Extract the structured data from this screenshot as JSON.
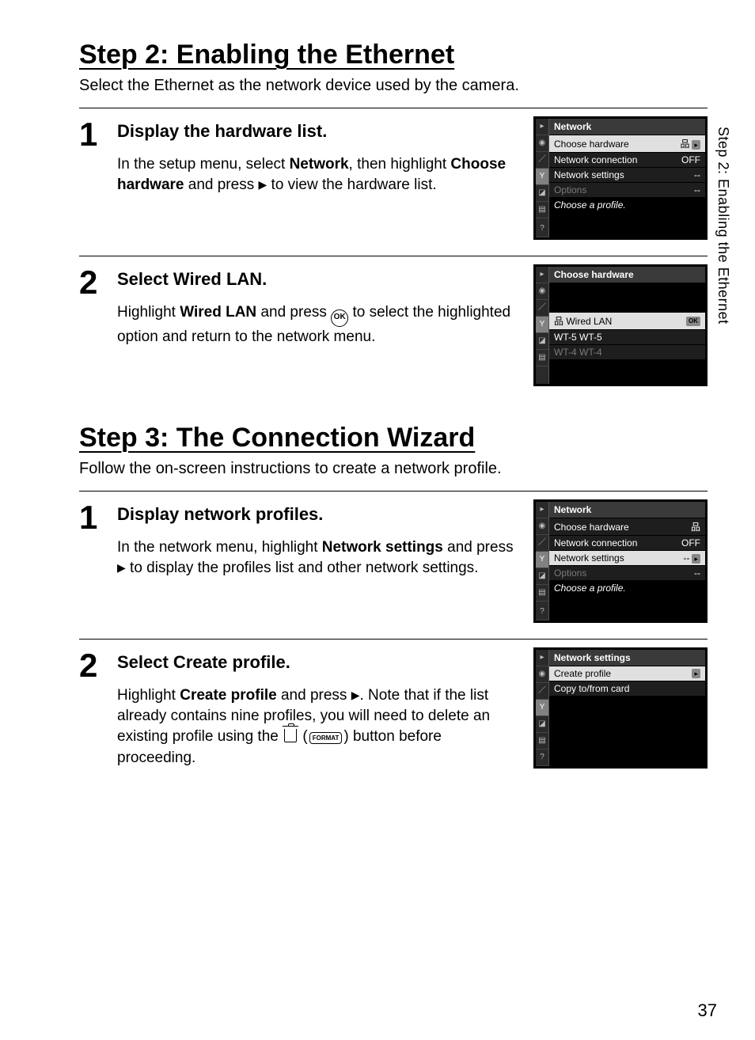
{
  "side_tab": "Step 2: Enabling the Ethernet",
  "step2": {
    "title": "Step 2: Enabling the Ethernet",
    "intro": "Select the Ethernet as the network device used by the camera.",
    "items": [
      {
        "num": "1",
        "heading": "Display the hardware list.",
        "body_pre": "In the setup menu, select ",
        "body_bold1": "Network",
        "body_mid": ", then highlight ",
        "body_bold2": "Choose hardware",
        "body_post": " and press ",
        "body_tail": " to view the hardware list.",
        "cam": {
          "title": "Network",
          "rows": [
            {
              "label": "Choose hardware",
              "val": "品",
              "hi": true,
              "arrow": true
            },
            {
              "label": "Network connection",
              "val": "OFF"
            },
            {
              "label": "Network settings",
              "val": "--"
            },
            {
              "label": "Options",
              "val": "--",
              "dim": true
            }
          ],
          "note": "Choose a profile."
        }
      },
      {
        "num": "2",
        "heading": "Select Wired LAN.",
        "body_pre": "Highlight ",
        "body_bold1": "Wired LAN",
        "body_mid": " and press ",
        "body_post": " to select the highlighted option and return to the network menu.",
        "cam": {
          "title": "Choose hardware",
          "rows": [
            {
              "label": "品  Wired LAN",
              "hi": true,
              "ok": true
            },
            {
              "label": "WT-5 WT-5"
            },
            {
              "label": "WT-4 WT-4",
              "dim": true
            }
          ]
        }
      }
    ]
  },
  "step3": {
    "title": "Step 3: The Connection Wizard",
    "intro": "Follow the on-screen instructions to create a network profile.",
    "items": [
      {
        "num": "1",
        "heading": "Display network profiles.",
        "body_pre": "In the network menu, highlight ",
        "body_bold1": "Network settings",
        "body_mid": " and press ",
        "body_post": " to display the profiles list and other network settings.",
        "cam": {
          "title": "Network",
          "rows": [
            {
              "label": "Choose hardware",
              "val": "品"
            },
            {
              "label": "Network connection",
              "val": "OFF"
            },
            {
              "label": "Network settings",
              "val": "--",
              "hi": true,
              "arrow": true
            },
            {
              "label": "Options",
              "val": "--",
              "dim": true
            }
          ],
          "note": "Choose a profile."
        }
      },
      {
        "num": "2",
        "heading": "Select Create profile.",
        "body_pre": "Highlight ",
        "body_bold1": "Create profile",
        "body_mid": " and press ",
        "body_post": ". Note that if the list already contains nine profiles, you will need to delete an existing profile using the ",
        "body_tail": " button before proceeding.",
        "cam": {
          "title": "Network settings",
          "rows": [
            {
              "label": "Create profile",
              "hi": true,
              "arrow": true
            },
            {
              "label": "Copy to/from card"
            }
          ]
        }
      }
    ]
  },
  "page_number": "37"
}
